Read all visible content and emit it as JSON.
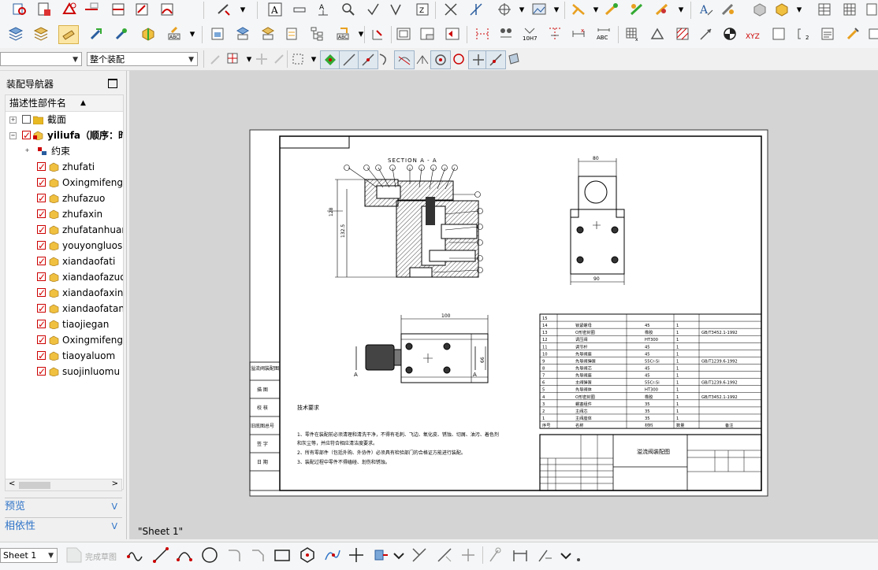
{
  "toolbar_row3": {
    "filter_dropdown": "",
    "scope_dropdown": "整个装配"
  },
  "navigator": {
    "title": "装配导航器",
    "column_header": "描述性部件名",
    "items": [
      {
        "label": "截面"
      },
      {
        "label": "yiliufa（顺序：时"
      },
      {
        "label": "约束"
      },
      {
        "label": "zhufati"
      },
      {
        "label": "Oxingmifeng"
      },
      {
        "label": "zhufazuo"
      },
      {
        "label": "zhufaxin"
      },
      {
        "label": "zhufatanhuang"
      },
      {
        "label": "youyongluosi"
      },
      {
        "label": "xiandaofati"
      },
      {
        "label": "xiandaofazuo"
      },
      {
        "label": "xiandaofaxin"
      },
      {
        "label": "xiandaofatanhuang"
      },
      {
        "label": "tiaojiegan"
      },
      {
        "label": "Oxingmifeng"
      },
      {
        "label": "tiaoyaluom"
      },
      {
        "label": "suojinluomu"
      }
    ],
    "panel_preview": "预览",
    "panel_dependency": "相依性"
  },
  "drawing": {
    "section_title": "SECTION  A - A",
    "sheet_label": "\"Sheet 1\"",
    "tech_req_title": "技术要求",
    "tech_req_lines": [
      "1、零件在装配前必须清理和清洗干净，不得有毛刺、飞边、氧化皮、锈蚀、切屑、油污、着色剂",
      "    和灰尘等，并应符合相应清洁度要求。",
      "2、所有零部件（包括外购、外协件）必须具有检验部门的合格证方能进行装配。",
      "3、装配过程中零件不得磕碰、划伤和锈蚀。"
    ],
    "dim_top_width": "80",
    "dim_bottom_width": "90",
    "dim_front_width": "100",
    "dim_height_1": "128",
    "dim_height_2": "132.5",
    "dim_side": "66",
    "section_mark": "A",
    "title_block_name": "溢流阀装配图",
    "bom_rows": [
      {
        "no": "15",
        "name": "",
        "qty": "",
        "material": "",
        "std": ""
      },
      {
        "no": "14",
        "name": "锁紧螺母",
        "material": "45",
        "qty": "1",
        "std": ""
      },
      {
        "no": "13",
        "name": "O形密封圈",
        "material": "橡胶",
        "qty": "1",
        "std": "GB/T3452.1-1992"
      },
      {
        "no": "12",
        "name": "调压阀",
        "material": "HT300",
        "qty": "1",
        "std": ""
      },
      {
        "no": "11",
        "name": "调节杆",
        "material": "45",
        "qty": "1",
        "std": ""
      },
      {
        "no": "10",
        "name": "先导阀座",
        "material": "45",
        "qty": "1",
        "std": ""
      },
      {
        "no": "9",
        "name": "先导阀弹簧",
        "material": "55Cr-Si",
        "qty": "1",
        "std": "GB/T1239.6-1992"
      },
      {
        "no": "8",
        "name": "先导阀芯",
        "material": "45",
        "qty": "1",
        "std": ""
      },
      {
        "no": "7",
        "name": "先导阀座",
        "material": "45",
        "qty": "1",
        "std": ""
      },
      {
        "no": "6",
        "name": "主阀弹簧",
        "material": "55Cr-Si",
        "qty": "1",
        "std": "GB/T1239.6-1992"
      },
      {
        "no": "5",
        "name": "先导阀体",
        "material": "HT300",
        "qty": "1",
        "std": ""
      },
      {
        "no": "4",
        "name": "O形密封圈",
        "material": "橡胶",
        "qty": "1",
        "std": "GB/T3452.1-1992"
      },
      {
        "no": "3",
        "name": "螺塞组件",
        "material": "35",
        "qty": "1",
        "std": ""
      },
      {
        "no": "2",
        "name": "主阀芯",
        "material": "35",
        "qty": "1",
        "std": ""
      },
      {
        "no": "1",
        "name": "主阀座体",
        "material": "35",
        "qty": "1",
        "std": ""
      }
    ],
    "bom_header": {
      "no": "序号",
      "name": "名称",
      "material": "材料",
      "qty": "数量",
      "std": "备注"
    },
    "side_labels": [
      "溢流阀装配图",
      "描 图",
      "校 核",
      "旧底图总号",
      "签 字",
      "日 期"
    ]
  },
  "bottom_bar": {
    "sheet_select": "Sheet 1",
    "finish_sketch": "完成草图"
  },
  "colors": {
    "accent_blue": "#2e73c7",
    "check_red": "#d40000",
    "canvas_gray": "#d4d4d4",
    "folder_yellow": "#e8b923"
  }
}
